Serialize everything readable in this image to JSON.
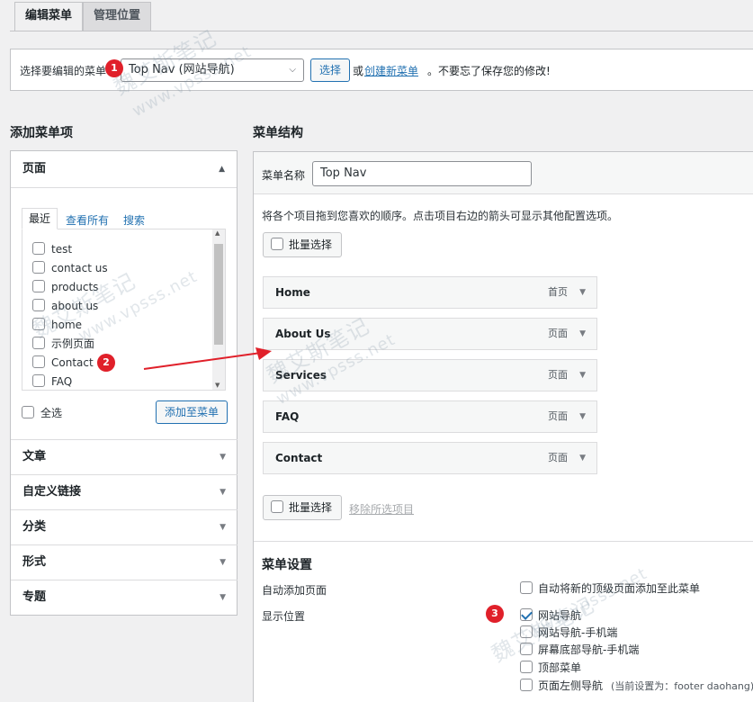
{
  "tabs": [
    {
      "label": "编辑菜单"
    },
    {
      "label": "管理位置"
    }
  ],
  "select_bar": {
    "prompt": "选择要编辑的菜单：",
    "selected_menu": "Top Nav (网站导航)",
    "select_button": "选择",
    "or_text": "或",
    "create_link": "创建新菜单",
    "reminder": "。不要忘了保存您的修改!"
  },
  "left": {
    "title": "添加菜单项",
    "pages_section": {
      "title": "页面",
      "subtabs": [
        "最近",
        "查看所有",
        "搜索"
      ],
      "items": [
        "test",
        "contact us",
        "products",
        "about us",
        "home",
        "示例页面",
        "Contact",
        "FAQ"
      ],
      "select_all": "全选",
      "add_button": "添加至菜单"
    },
    "other_sections": [
      "文章",
      "自定义链接",
      "分类",
      "形式",
      "专题"
    ]
  },
  "right": {
    "title": "菜单结构",
    "name_label": "菜单名称",
    "name_value": "Top Nav",
    "instructions": "将各个项目拖到您喜欢的顺序。点击项目右边的箭头可显示其他配置选项。",
    "bulk_select": "批量选择",
    "remove_selected": "移除所选项目",
    "menu_items": [
      {
        "title": "Home",
        "type": "首页"
      },
      {
        "title": "About Us",
        "type": "页面"
      },
      {
        "title": "Services",
        "type": "页面"
      },
      {
        "title": "FAQ",
        "type": "页面"
      },
      {
        "title": "Contact",
        "type": "页面"
      }
    ],
    "settings": {
      "title": "菜单设置",
      "auto_add_label": "自动添加页面",
      "auto_add_option": "自动将新的顶级页面添加至此菜单",
      "location_label": "显示位置",
      "locations": [
        {
          "label": "网站导航",
          "checked": true
        },
        {
          "label": "网站导航-手机端",
          "checked": false
        },
        {
          "label": "屏幕底部导航-手机端",
          "checked": false
        },
        {
          "label": "顶部菜单",
          "checked": false
        },
        {
          "label": "页面左侧导航",
          "checked": false,
          "note": "(当前设置为：footer daohang)"
        }
      ]
    }
  },
  "annotations": {
    "badges": [
      "1",
      "2",
      "3"
    ],
    "accent_color": "#e0202a"
  },
  "watermark": {
    "text_cn": "魏艾斯笔记",
    "text_url": "www.vpsss.net"
  }
}
